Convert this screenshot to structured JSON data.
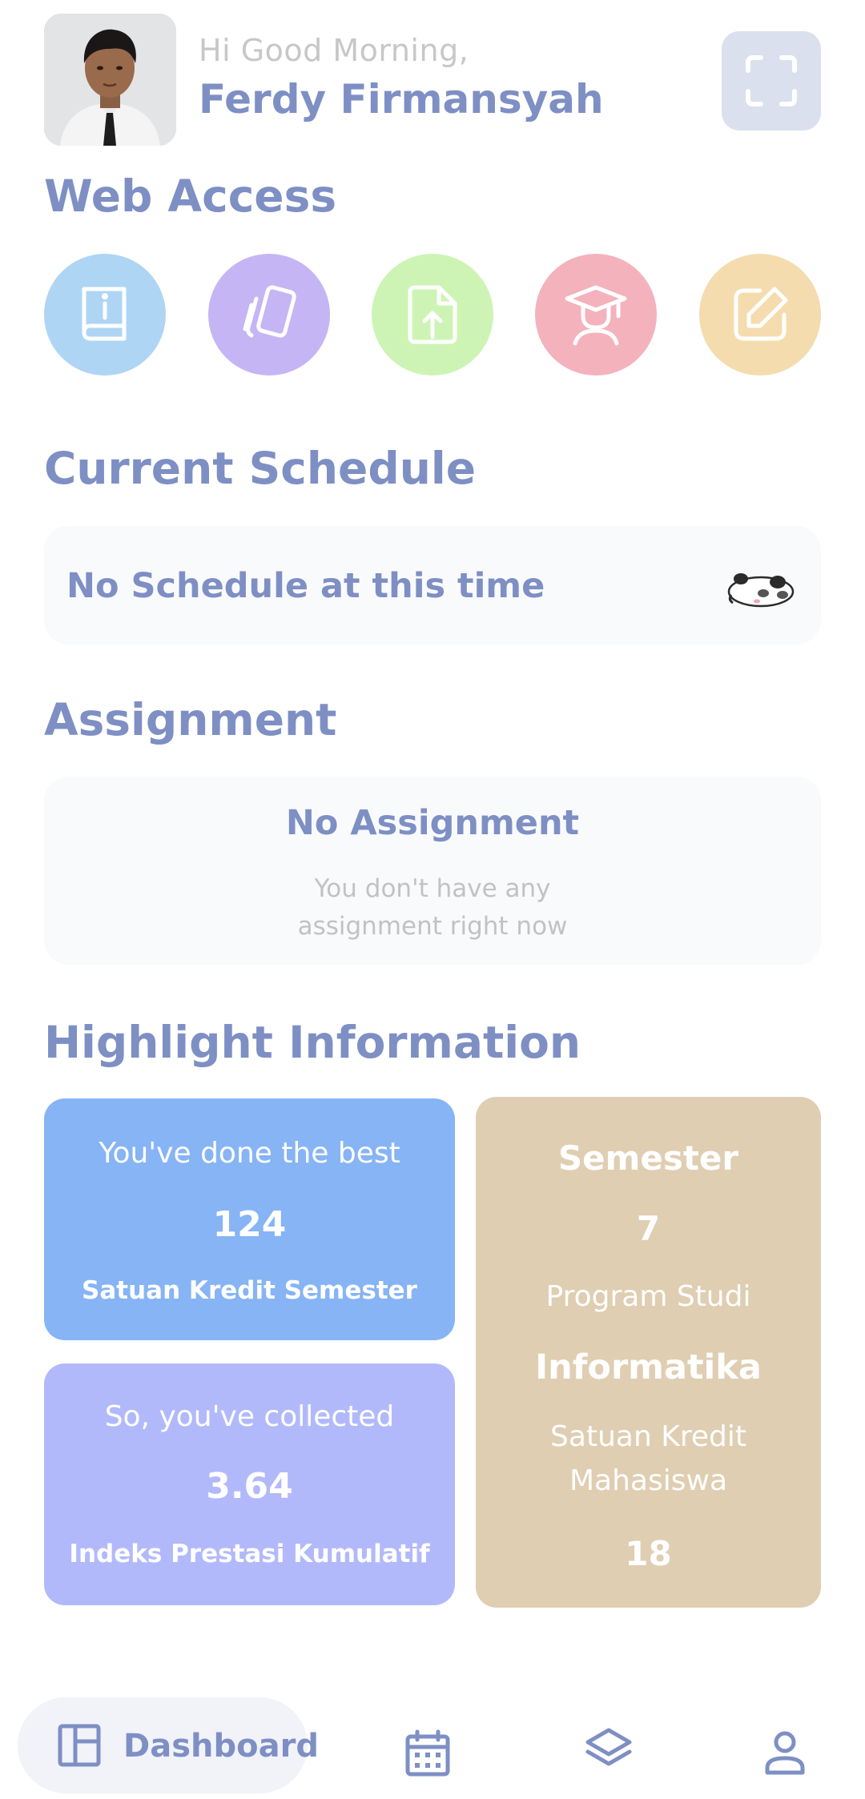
{
  "header": {
    "greeting": "Hi Good Morning,",
    "user_name": "Ferdy Firmansyah"
  },
  "web_access": {
    "title": "Web Access",
    "items": [
      {
        "icon": "info-book-icon",
        "color": "#afd5f5"
      },
      {
        "icon": "cards-icon",
        "color": "#c5b5f4"
      },
      {
        "icon": "file-upload-icon",
        "color": "#cdf4b5"
      },
      {
        "icon": "graduation-icon",
        "color": "#f4b2bd"
      },
      {
        "icon": "edit-icon",
        "color": "#f4dcae"
      }
    ]
  },
  "schedule": {
    "title": "Current Schedule",
    "empty_text": "No Schedule at this time"
  },
  "assignment": {
    "title": "Assignment",
    "empty_title": "No Assignment",
    "empty_line1": "You don't have any",
    "empty_line2": "assignment right now"
  },
  "highlight": {
    "title": "Highlight Information",
    "sks": {
      "caption": "You've done the best",
      "value": "124",
      "label": "Satuan Kredit Semester",
      "color": "#86b4f5"
    },
    "ipk": {
      "caption": "So, you've collected",
      "value": "3.64",
      "label": "Indeks Prestasi Kumulatif",
      "color": "#b2b9fb"
    },
    "semester": {
      "label": "Semester",
      "value": "7",
      "program_label": "Program Studi",
      "program_value": "Informatika",
      "skm_label_line1": "Satuan Kredit",
      "skm_label_line2": "Mahasiswa",
      "skm_value": "18",
      "color": "#dfceb2"
    }
  },
  "bottom_nav": {
    "dashboard_label": "Dashboard",
    "items": [
      "dashboard-icon",
      "calendar-icon",
      "layers-icon",
      "profile-icon"
    ]
  },
  "colors": {
    "accent": "#7e8fc4",
    "muted": "#c7c7c7"
  }
}
